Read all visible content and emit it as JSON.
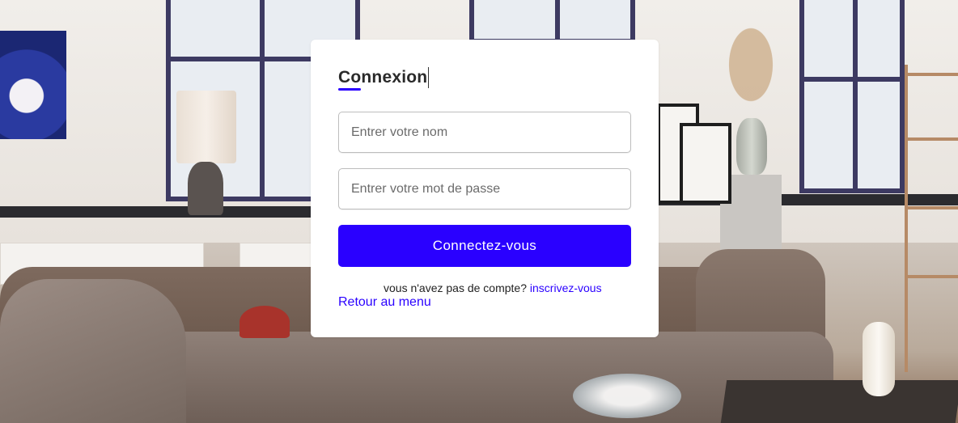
{
  "login": {
    "title": "Connexion",
    "name_placeholder": "Entrer votre nom",
    "password_placeholder": "Entrer votre mot de passe",
    "submit_label": "Connectez-vous",
    "signup_prompt": "vous n'avez pas de compte?",
    "signup_link": "inscrivez-vous",
    "back_link": "Retour au menu"
  },
  "colors": {
    "accent": "#2a00ff",
    "card_background": "#ffffff"
  }
}
